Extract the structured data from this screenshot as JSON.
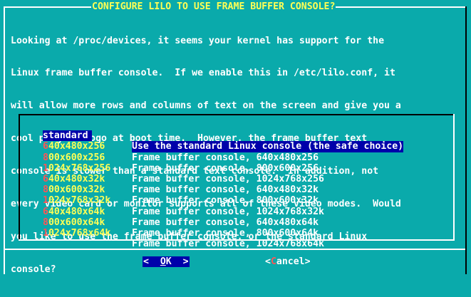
{
  "title": "CONFIGURE LILO TO USE FRAME BUFFER CONSOLE?",
  "description_lines": [
    "Looking at /proc/devices, it seems your kernel has support for the",
    "Linux frame buffer console.  If we enable this in /etc/lilo.conf, it",
    "will allow more rows and columns of text on the screen and give you a",
    "cool penguin logo at boot time.  However, the frame buffer text",
    "console is slower than a standard text console.  In addition, not",
    "every video card or monitor supports all of these video modes.  Would",
    "you like to use the frame buffer console, or the standard Linux",
    "console?"
  ],
  "options": [
    {
      "tag_hot": "s",
      "tag_rest": "tandard",
      "item": "Use the standard Linux console (the safe choice)",
      "selected": true
    },
    {
      "tag_hot": "6",
      "tag_rest": "40x480x256",
      "item": "Frame buffer console, 640x480x256"
    },
    {
      "tag_hot": "8",
      "tag_rest": "00x600x256",
      "item": "Frame buffer console, 800x600x256"
    },
    {
      "tag_hot": "1",
      "tag_rest": "024x768x256",
      "item": "Frame buffer console, 1024x768x256"
    },
    {
      "tag_hot": "6",
      "tag_rest": "40x480x32k",
      "item": "Frame buffer console, 640x480x32k"
    },
    {
      "tag_hot": "8",
      "tag_rest": "00x600x32k",
      "item": "Frame buffer console, 800x600x32k"
    },
    {
      "tag_hot": "1",
      "tag_rest": "024x768x32k",
      "item": "Frame buffer console, 1024x768x32k"
    },
    {
      "tag_hot": "6",
      "tag_rest": "40x480x64k",
      "item": "Frame buffer console, 640x480x64k"
    },
    {
      "tag_hot": "8",
      "tag_rest": "00x600x64k",
      "item": "Frame buffer console, 800x600x64k"
    },
    {
      "tag_hot": "1",
      "tag_rest": "024x768x64k",
      "item": "Frame buffer console, 1024x768x64k"
    }
  ],
  "buttons": {
    "ok": {
      "prefix": "<  ",
      "hot": "O",
      "rest": "K",
      "suffix": "  >"
    },
    "cancel": {
      "prefix": "<",
      "hot": "C",
      "rest": "ancel",
      "suffix": ">"
    }
  },
  "colors": {
    "background": "#0aaaab",
    "title": "#ffff55",
    "selection": "#0000aa",
    "hotkey": "#ff5555",
    "text": "#ffffff"
  }
}
